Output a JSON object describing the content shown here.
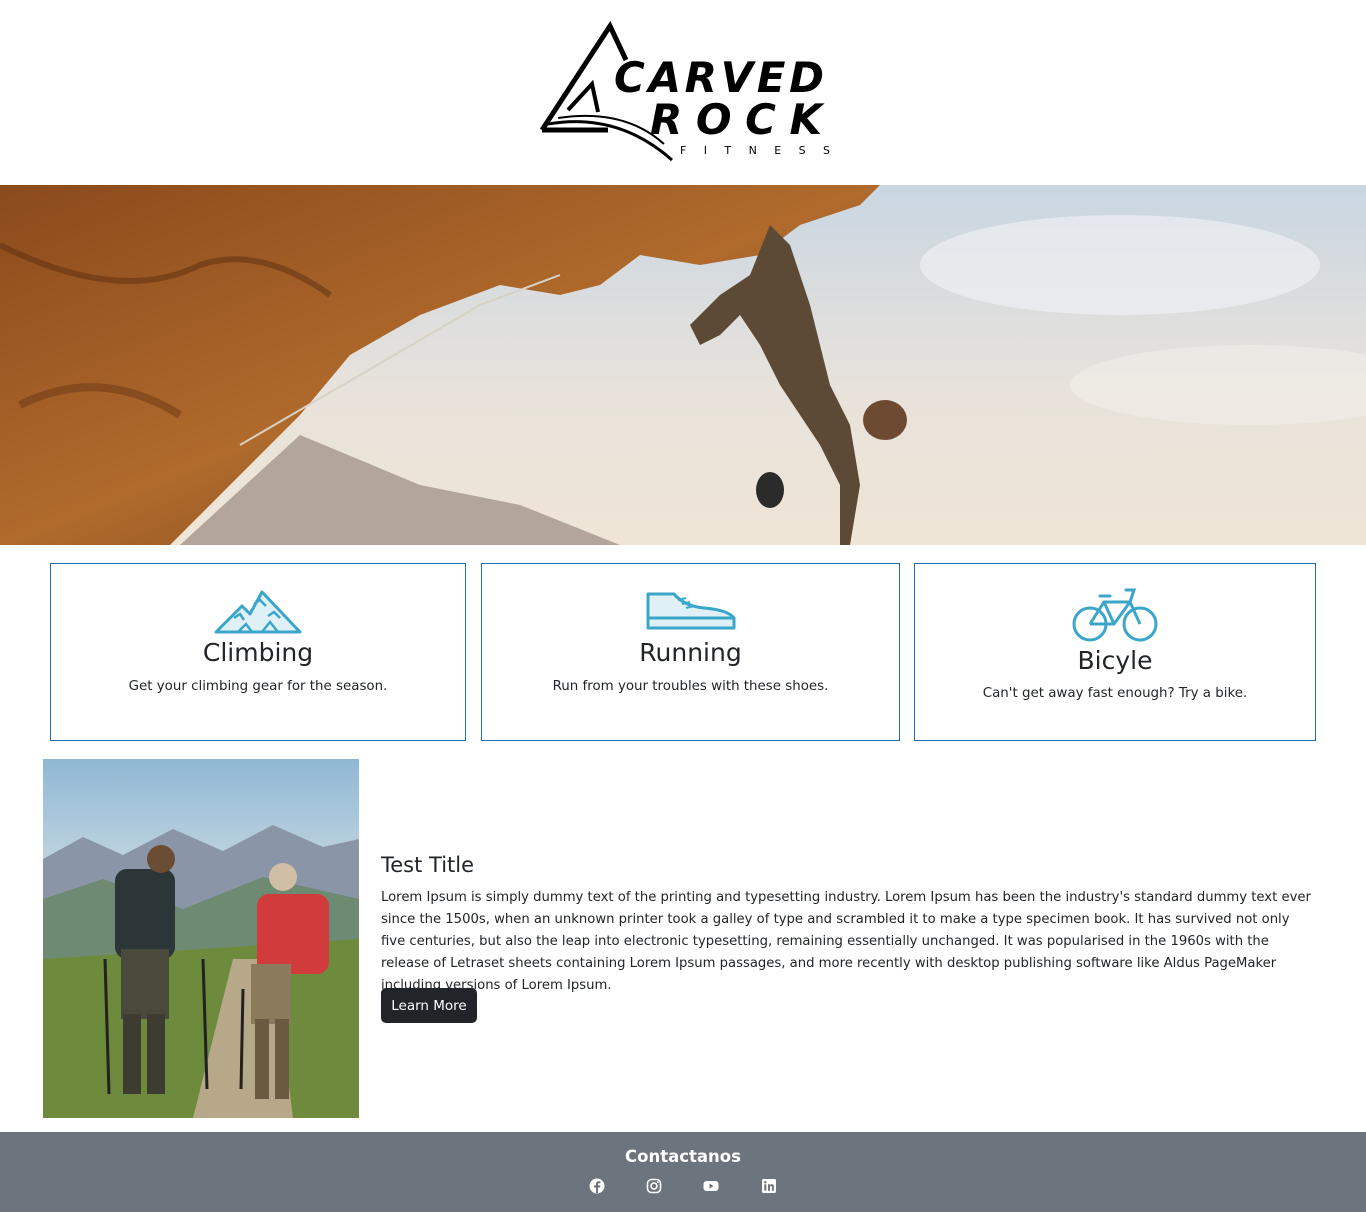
{
  "brand": {
    "logo_line1": "CARVED",
    "logo_line2": "ROCK",
    "logo_line3": "F I T N E S S"
  },
  "hero": {
    "image": "rock-climber-hero"
  },
  "cards": [
    {
      "icon": "mountains-icon",
      "title": "Climbing",
      "description": "Get your climbing gear for the season."
    },
    {
      "icon": "sneaker-icon",
      "title": "Running",
      "description": "Run from your troubles with these shoes."
    },
    {
      "icon": "bicycle-icon",
      "title": "Bicyle",
      "description": "Can't get away fast enough? Try a bike."
    }
  ],
  "feature": {
    "image": "hikers-photo",
    "title": "Test Title",
    "text": "Lorem Ipsum is simply dummy text of the printing and typesetting industry. Lorem Ipsum has been the industry's standard dummy text ever since the 1500s, when an unknown printer took a galley of type and scrambled it to make a type specimen book. It has survived not only five centuries, but also the leap into electronic typesetting, remaining essentially unchanged. It was popularised in the 1960s with the release of Letraset sheets containing Lorem Ipsum passages, and more recently with desktop publishing software like Aldus PageMaker including versions of Lorem Ipsum.",
    "button_label": "Learn More"
  },
  "footer": {
    "title": "Contactanos",
    "social": [
      "facebook-icon",
      "instagram-icon",
      "youtube-icon",
      "linkedin-icon"
    ]
  },
  "colors": {
    "accent_icon": "#3aa6c9",
    "card_border": "#1f6fc0",
    "button_bg": "#212529",
    "footer_bg": "#6c757d"
  }
}
